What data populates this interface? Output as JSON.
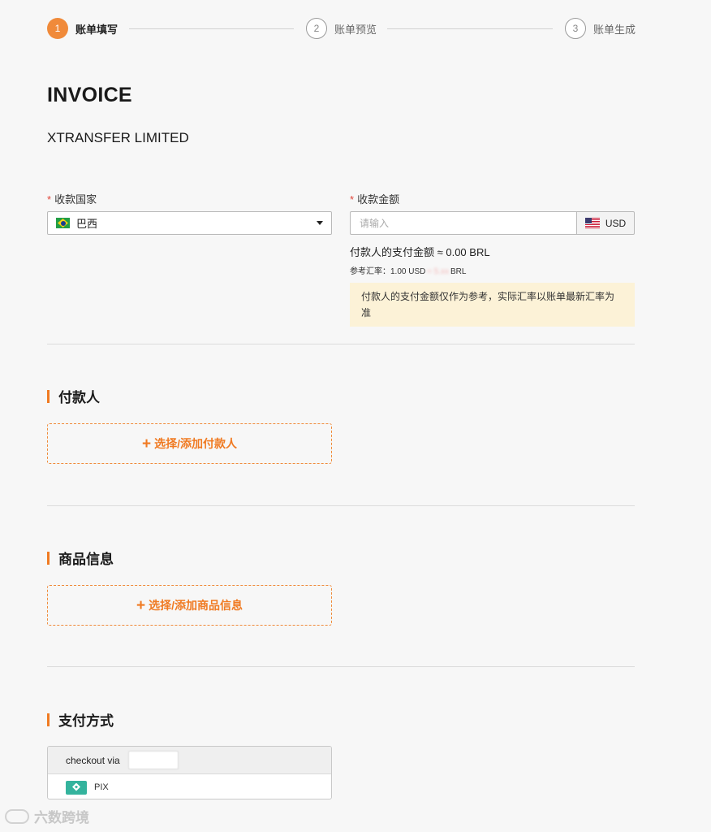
{
  "steps": [
    {
      "number": "1",
      "label": "账单填写",
      "active": true
    },
    {
      "number": "2",
      "label": "账单预览",
      "active": false
    },
    {
      "number": "3",
      "label": "账单生成",
      "active": false
    }
  ],
  "invoice_title": "INVOICE",
  "company_name": "XTRANSFER LIMITED",
  "country_field": {
    "label": "收款国家",
    "required_mark": "*",
    "value": "巴西",
    "flag_icon": "brazil-flag-icon"
  },
  "amount_field": {
    "label": "收款金额",
    "required_mark": "*",
    "placeholder": "请输入",
    "currency": "USD",
    "currency_flag_icon": "us-flag-icon"
  },
  "payer_amount_text": "付款人的支付金额 ≈ 0.00 BRL",
  "reference_rate": {
    "prefix": "参考汇率：1.00 USD",
    "hidden_value": "≈ 5.xx",
    "suffix": "BRL"
  },
  "rate_notice": "付款人的支付金额仅作为参考，实际汇率以账单最新汇率为准",
  "payer_section": {
    "title": "付款人",
    "add_icon": "+",
    "add_label": "选择/添加付款人"
  },
  "goods_section": {
    "title": "商品信息",
    "add_icon": "+",
    "add_label": "选择/添加商品信息"
  },
  "payment_section": {
    "title": "支付方式",
    "checkout_label": "checkout via",
    "method_label": "PIX",
    "method_icon": "pix-icon"
  },
  "watermark": "六数跨境",
  "colors": {
    "accent": "#f07a22",
    "notice_bg": "#fcf2d7",
    "required": "#e0463a",
    "pix": "#34b39d"
  }
}
